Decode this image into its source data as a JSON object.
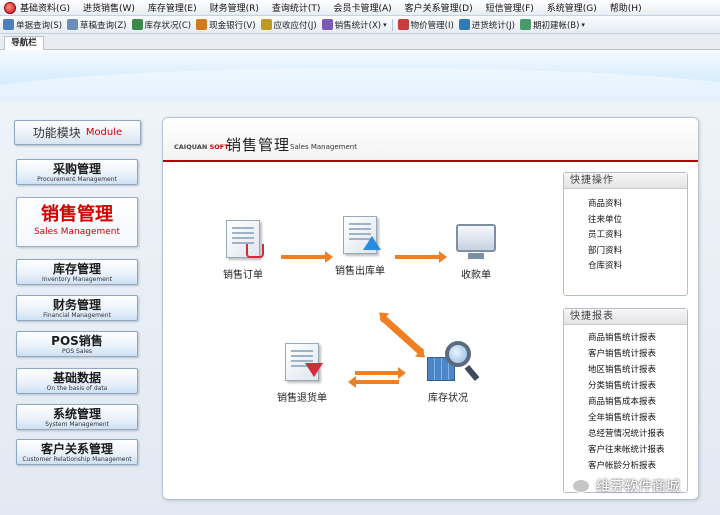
{
  "menu": {
    "items": [
      "基础资料(G)",
      "进货销售(W)",
      "库存管理(E)",
      "财务管理(R)",
      "查询统计(T)",
      "会员卡管理(A)",
      "客户关系管理(D)",
      "短信管理(F)",
      "系统管理(G)",
      "帮助(H)"
    ]
  },
  "toolbar": {
    "buttons": [
      {
        "label": "单据查询(S)",
        "icon": "document-search-icon",
        "color": "#4a7fc0"
      },
      {
        "label": "草稿查询(Z)",
        "icon": "draft-icon",
        "color": "#6b8fb8"
      },
      {
        "label": "库存状况(C)",
        "icon": "inventory-icon",
        "color": "#3b8a4a"
      },
      {
        "label": "现金银行(V)",
        "icon": "cash-bank-icon",
        "color": "#d07a20"
      },
      {
        "label": "应收应付(J)",
        "icon": "receivable-payable-icon",
        "color": "#c09a20"
      },
      {
        "label": "销售统计(X)",
        "icon": "sales-stats-icon",
        "color": "#7a5ab8"
      },
      {
        "label": "物价管理(I)",
        "icon": "price-icon",
        "color": "#c83c3c"
      },
      {
        "label": "进货统计(J)",
        "icon": "purchase-stats-icon",
        "color": "#2f7ab8"
      },
      {
        "label": "期初建帐(B)",
        "icon": "opening-account-icon",
        "color": "#4a9a6a"
      }
    ]
  },
  "nav": {
    "tab_label": "导航栏"
  },
  "modules": {
    "header_cn": "功能模块",
    "header_en": "Module",
    "items": [
      {
        "cn": "采购管理",
        "en": "Procurement Management"
      },
      {
        "cn": "销售管理",
        "en": "Sales Management"
      },
      {
        "cn": "库存管理",
        "en": "Inventory Management"
      },
      {
        "cn": "财务管理",
        "en": "Financial Management"
      },
      {
        "cn": "POS销售",
        "en": "POS Sales"
      },
      {
        "cn": "基础数据",
        "en": "On the basis of data"
      },
      {
        "cn": "系统管理",
        "en": "System Management"
      },
      {
        "cn": "客户关系管理",
        "en": "Customer Relationship Management"
      }
    ]
  },
  "content": {
    "brand": "CAIQUAN",
    "brand_soft": "SOFT",
    "title": "销售管理",
    "subtitle": "Sales Management",
    "flow": {
      "order": "销售订单",
      "outbound": "销售出库单",
      "receipt": "收款单",
      "return": "销售退货单",
      "stock": "库存状况"
    },
    "quick_ops": {
      "title": "快捷操作",
      "items": [
        "商品资料",
        "往来单位",
        "员工资料",
        "部门资料",
        "仓库资料"
      ]
    },
    "quick_reports": {
      "title": "快捷报表",
      "items": [
        "商品销售统计报表",
        "客户销售统计报表",
        "地区销售统计报表",
        "分类销售统计报表",
        "商品销售成本报表",
        "全年销售统计报表",
        "总经营情况统计报表",
        "客户往来帐统计报表",
        "客户帐龄分析报表"
      ]
    }
  },
  "watermark": "维芬软件商城"
}
